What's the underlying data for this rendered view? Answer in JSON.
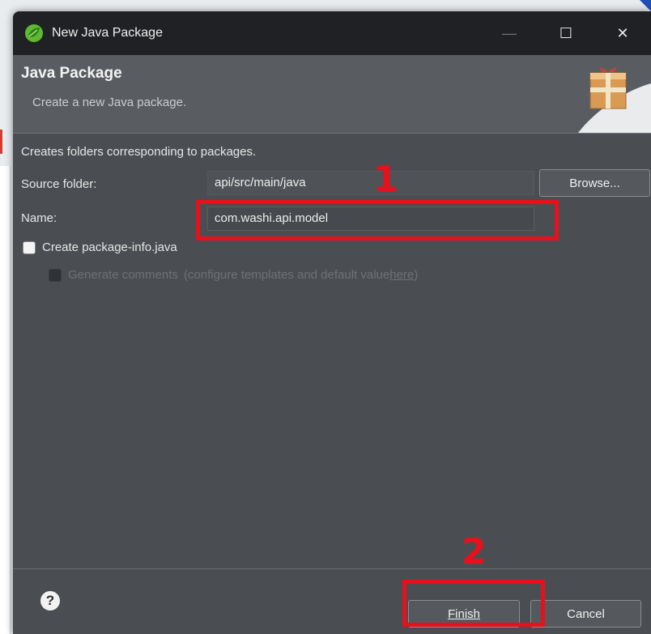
{
  "window": {
    "title": "New Java Package",
    "min_glyph": "—",
    "max_glyph": "☐",
    "close_glyph": "✕"
  },
  "banner": {
    "title": "Java Package",
    "subtitle": "Create a new Java package."
  },
  "form": {
    "intro": "Creates folders corresponding to packages.",
    "source_folder_label": "Source folder:",
    "source_folder_value": "api/src/main/java",
    "browse_label": "Browse...",
    "name_label": "Name:",
    "name_value": "com.washi.api.model",
    "create_package_info_label": "Create package-info.java",
    "create_package_info_checked": false,
    "generate_comments_label": "Generate comments",
    "generate_comments_note_prefix": "(configure templates and default value ",
    "generate_comments_link": "here",
    "generate_comments_note_suffix": ")"
  },
  "footer": {
    "help_glyph": "?",
    "finish_label": "Finish",
    "cancel_label": "Cancel"
  },
  "annotations": {
    "marker_1": "1",
    "marker_2": "2",
    "color": "#e8101b"
  },
  "colors": {
    "titlebar": "#202124",
    "dialog_bg": "#4a4e52",
    "banner_bg": "#595d61"
  },
  "icons": {
    "app": "eclipse-sts-leaf-icon",
    "banner": "package-wizard-icon",
    "help": "help-icon"
  }
}
